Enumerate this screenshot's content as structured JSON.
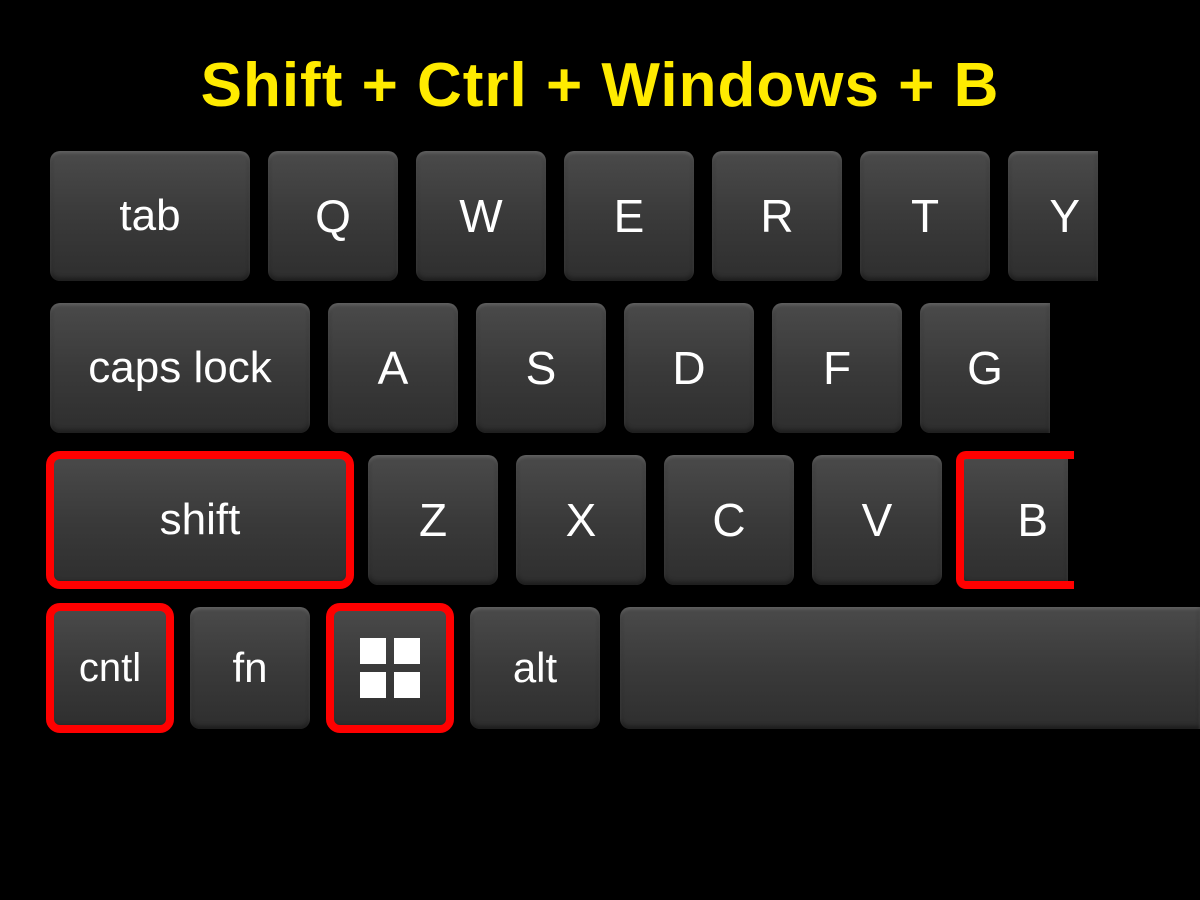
{
  "title": "Shift + Ctrl + Windows + B",
  "rows": {
    "r1": {
      "tab": "tab",
      "q": "Q",
      "w": "W",
      "e": "E",
      "r": "R",
      "t": "T",
      "y": "Y"
    },
    "r2": {
      "caps": "caps lock",
      "a": "A",
      "s": "S",
      "d": "D",
      "f": "F",
      "g": "G"
    },
    "r3": {
      "shift": "shift",
      "z": "Z",
      "x": "X",
      "c": "C",
      "v": "V",
      "b": "B"
    },
    "r4": {
      "cntl": "cntl",
      "fn": "fn",
      "alt": "alt"
    }
  },
  "highlighted_keys": [
    "shift",
    "cntl",
    "windows",
    "B"
  ],
  "colors": {
    "title": "#ffeb00",
    "highlight": "#ff0000",
    "key_text": "#ffffff"
  }
}
